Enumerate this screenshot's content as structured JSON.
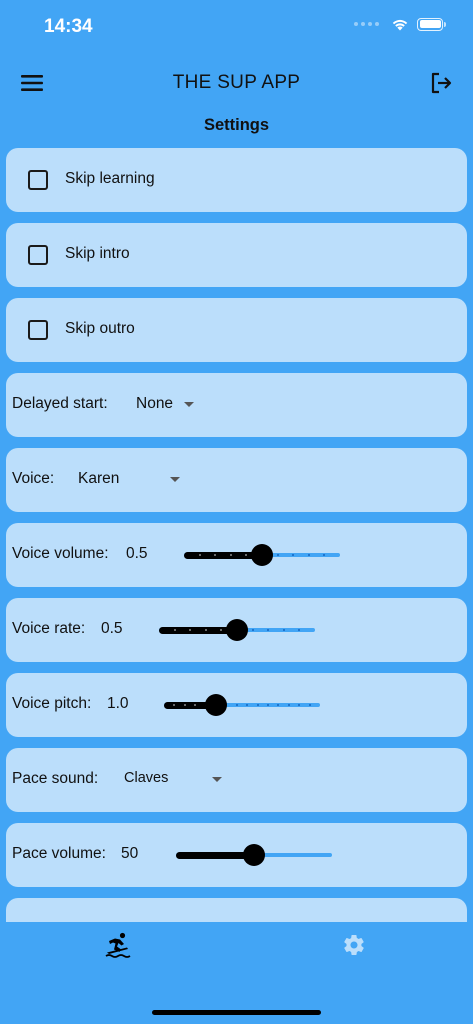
{
  "status_bar": {
    "time": "14:34"
  },
  "app_bar": {
    "title": "THE SUP APP"
  },
  "page": {
    "title": "Settings"
  },
  "checkboxes": [
    {
      "label": "Skip learning",
      "checked": false
    },
    {
      "label": "Skip intro",
      "checked": false
    },
    {
      "label": "Skip outro",
      "checked": false
    }
  ],
  "delayed_start": {
    "label": "Delayed start:",
    "value": "None"
  },
  "voice": {
    "label": "Voice:",
    "value": "Karen"
  },
  "voice_volume": {
    "label": "Voice volume:",
    "value": "0.5",
    "fraction": 0.5,
    "divisions": 10
  },
  "voice_rate": {
    "label": "Voice rate:",
    "value": "0.5",
    "fraction": 0.5,
    "divisions": 10
  },
  "voice_pitch": {
    "label": "Voice pitch:",
    "value": "1.0",
    "fraction": 0.333,
    "divisions": 15
  },
  "pace_sound": {
    "label": "Pace sound:",
    "value": "Claves"
  },
  "pace_volume": {
    "label": "Pace volume:",
    "value": "50",
    "fraction": 0.5
  },
  "nav": [
    {
      "icon": "surfing-icon",
      "active": true
    },
    {
      "icon": "gear-icon",
      "active": false
    }
  ],
  "colors": {
    "background": "#42a5f5",
    "card": "#bbdefb",
    "slider_active": "#000000",
    "slider_inactive": "#42a5f5"
  }
}
